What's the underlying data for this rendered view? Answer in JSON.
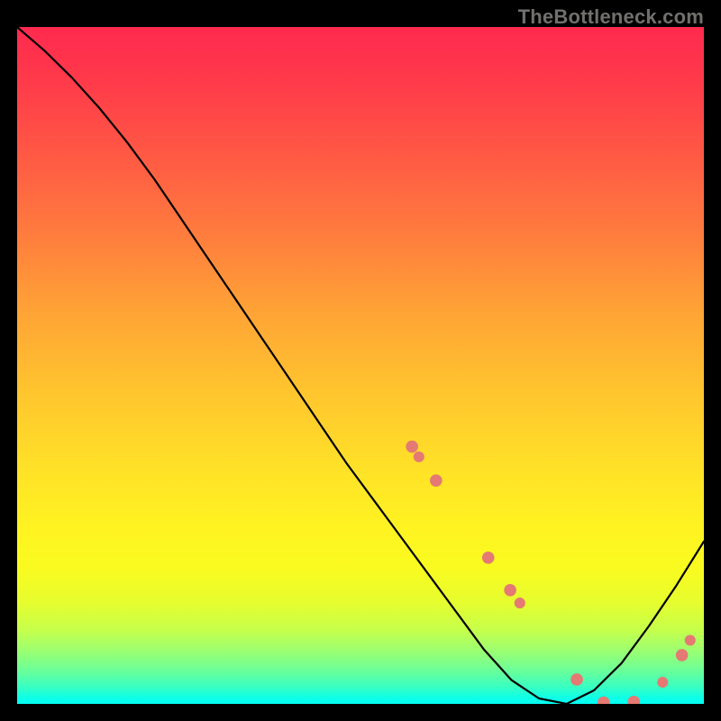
{
  "watermark": "TheBottleneck.com",
  "chart_data": {
    "type": "line",
    "title": "",
    "xlabel": "",
    "ylabel": "",
    "x_range": [
      0,
      100
    ],
    "y_range": [
      0,
      100
    ],
    "grid": false,
    "series": [
      {
        "name": "bottleneck-curve",
        "x": [
          0,
          4,
          8,
          12,
          16,
          20,
          24,
          28,
          32,
          36,
          40,
          44,
          48,
          52,
          56,
          60,
          64,
          68,
          72,
          76,
          80,
          84,
          88,
          92,
          96,
          100
        ],
        "y": [
          100,
          96.5,
          92.5,
          88,
          83,
          77.5,
          71.5,
          65.5,
          59.5,
          53.5,
          47.5,
          41.5,
          35.5,
          30,
          24.5,
          19,
          13.5,
          8,
          3.5,
          0.8,
          0,
          2,
          6,
          11.5,
          17.5,
          24
        ]
      }
    ],
    "markers": [
      {
        "shape": "dot",
        "x": 57.5,
        "y": 38.0,
        "r": 0.9
      },
      {
        "shape": "dot",
        "x": 58.5,
        "y": 36.5,
        "r": 0.8
      },
      {
        "shape": "pill",
        "x1": 59.0,
        "y1": 35.8,
        "x2": 60.3,
        "y2": 34.0,
        "w": 1.8
      },
      {
        "shape": "dot",
        "x": 61.0,
        "y": 33.0,
        "r": 0.9
      },
      {
        "shape": "pill",
        "x1": 61.2,
        "y1": 32.6,
        "x2": 63.2,
        "y2": 29.6,
        "w": 2.0
      },
      {
        "shape": "pill",
        "x1": 63.2,
        "y1": 29.6,
        "x2": 66.5,
        "y2": 24.8,
        "w": 2.0
      },
      {
        "shape": "pill",
        "x1": 66.3,
        "y1": 25.0,
        "x2": 68.0,
        "y2": 22.5,
        "w": 2.0
      },
      {
        "shape": "dot",
        "x": 68.6,
        "y": 21.6,
        "r": 0.9
      },
      {
        "shape": "pill",
        "x1": 69.5,
        "y1": 20.3,
        "x2": 70.8,
        "y2": 18.3,
        "w": 2.0
      },
      {
        "shape": "dot",
        "x": 71.8,
        "y": 16.8,
        "r": 0.9
      },
      {
        "shape": "dot",
        "x": 73.2,
        "y": 14.9,
        "r": 0.8
      },
      {
        "shape": "pill",
        "x1": 76.0,
        "y1": 11.0,
        "x2": 77.8,
        "y2": 8.5,
        "w": 1.9
      },
      {
        "shape": "pill",
        "x1": 79.3,
        "y1": 6.6,
        "x2": 80.3,
        "y2": 5.2,
        "w": 1.9
      },
      {
        "shape": "dot",
        "x": 81.5,
        "y": 3.6,
        "r": 0.9
      },
      {
        "shape": "pill",
        "x1": 82.3,
        "y1": 2.8,
        "x2": 84.0,
        "y2": 1.0,
        "w": 2.0
      },
      {
        "shape": "dot",
        "x": 85.4,
        "y": 0.2,
        "r": 0.9
      },
      {
        "shape": "pill",
        "x1": 86.3,
        "y1": 0.0,
        "x2": 88.3,
        "y2": 0.0,
        "w": 2.0
      },
      {
        "shape": "dot",
        "x": 89.8,
        "y": 0.3,
        "r": 0.9
      },
      {
        "shape": "pill",
        "x1": 90.9,
        "y1": 0.7,
        "x2": 92.2,
        "y2": 1.3,
        "w": 1.9
      },
      {
        "shape": "dot",
        "x": 94.0,
        "y": 3.2,
        "r": 0.8
      },
      {
        "shape": "dot",
        "x": 96.8,
        "y": 7.2,
        "r": 0.9
      },
      {
        "shape": "dot",
        "x": 98.0,
        "y": 9.4,
        "r": 0.8
      }
    ],
    "colors": {
      "curve": "#000000",
      "marker": "#e47a73",
      "gradient_top": "#ff2a4f",
      "gradient_bottom": "#00fff5"
    }
  }
}
